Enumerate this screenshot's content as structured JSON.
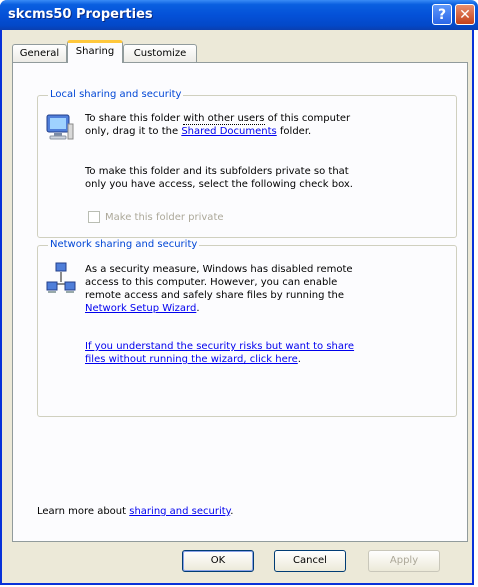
{
  "window": {
    "title": "skcms50 Properties",
    "help_glyph": "?",
    "close_glyph": "✕"
  },
  "tabs": [
    {
      "label": "General",
      "selected": false
    },
    {
      "label": "Sharing",
      "selected": true
    },
    {
      "label": "Customize",
      "selected": false
    }
  ],
  "local": {
    "legend": "Local sharing and security",
    "line1_part1": "To share this folder ",
    "line1_dotted": "with other users",
    "line1_part2": " of this computer",
    "line2_part1": "only, drag it to the ",
    "line2_link": "Shared Documents",
    "line2_part2": " folder.",
    "private_text_1": "To make this folder and its subfolders private so that",
    "private_text_2": "only you have access, select the following check box.",
    "checkbox_label": "Make this folder private",
    "checkbox_checked": false
  },
  "network": {
    "legend": "Network sharing and security",
    "text_1": "As a security measure, Windows has disabled remote",
    "text_2": "access to this computer. However, you can enable",
    "text_3": "remote access and safely share files by running the",
    "wizard_link": "Network Setup Wizard",
    "wizard_link_suffix": ".",
    "risk_link_1": "If you understand the security risks but want to share",
    "risk_link_2": "files without running the wizard, click here",
    "risk_link_suffix": "."
  },
  "footer": {
    "learn_prefix": "Learn more about ",
    "learn_link": "sharing and security",
    "learn_suffix": "."
  },
  "buttons": {
    "ok": "OK",
    "cancel": "Cancel",
    "apply": "Apply"
  }
}
